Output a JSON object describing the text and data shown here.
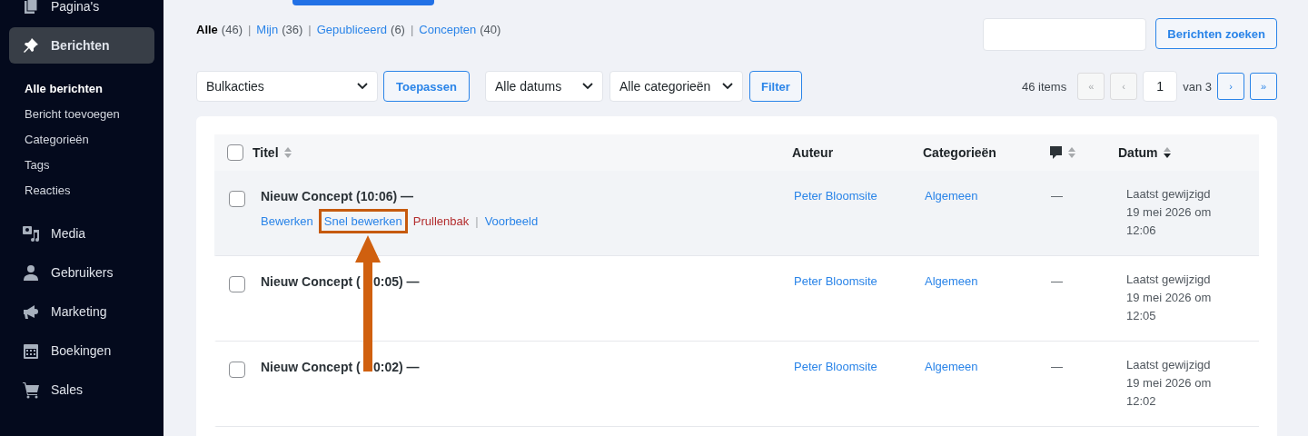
{
  "sidebar": {
    "items": [
      {
        "label": "Pagina's",
        "selected": false
      },
      {
        "label": "Berichten",
        "selected": true,
        "children": [
          {
            "label": "Alle berichten",
            "selected": true
          },
          {
            "label": "Bericht toevoegen",
            "selected": false
          },
          {
            "label": "Categorieën",
            "selected": false
          },
          {
            "label": "Tags",
            "selected": false
          },
          {
            "label": "Reacties",
            "selected": false
          }
        ]
      },
      {
        "label": "Media",
        "selected": false
      },
      {
        "label": "Gebruikers",
        "selected": false
      },
      {
        "label": "Marketing",
        "selected": false
      },
      {
        "label": "Boekingen",
        "selected": false
      },
      {
        "label": "Sales",
        "selected": false
      }
    ]
  },
  "filters": [
    {
      "label": "Alle",
      "count": "(46)",
      "selected": true
    },
    {
      "separator": "|",
      "label": "Mijn",
      "count": "(36)",
      "selected": false
    },
    {
      "separator": "|",
      "label": "Gepubliceerd",
      "count": "(6)",
      "selected": false
    },
    {
      "separator": "|",
      "label": "Concepten",
      "count": "(40)",
      "selected": false
    }
  ],
  "search": {
    "button": "Berichten zoeken"
  },
  "toolbar": {
    "bulk": "Bulkacties",
    "apply": "Toepassen",
    "dates": "Alle datums",
    "categories": "Alle categorieën",
    "filter": "Filter"
  },
  "pagination": {
    "items": "46 items",
    "first": "«",
    "prev": "‹",
    "page": "1",
    "of": "van 3",
    "next": "›",
    "last": "»"
  },
  "table": {
    "columns": [
      {
        "kind": "check",
        "checked": false
      },
      {
        "kind": "text",
        "label": "Titel",
        "sorted": false
      },
      {
        "kind": "text",
        "label": "Auteur"
      },
      {
        "kind": "text",
        "label": "Categorieën"
      },
      {
        "kind": "comments",
        "sorted": false
      },
      {
        "kind": "text",
        "label": "Datum",
        "sorted": true
      }
    ],
    "rows": [
      {
        "title_parts": [
          "Nieuw Concept (10:06) —"
        ],
        "checked": false,
        "hovered": true,
        "actions": [
          {
            "label": "Bewerken",
            "kind": "link",
            "highlighted": false
          },
          {
            "label": "Snel bewerken",
            "kind": "link",
            "highlighted": true
          },
          {
            "label": "Prullenbak",
            "kind": "delete",
            "highlighted": false
          },
          {
            "separator": "|",
            "label": "Voorbeeld",
            "kind": "link",
            "highlighted": false
          }
        ],
        "author": "Peter Bloomsite",
        "category": "Algemeen",
        "comments": "—",
        "date": [
          "Laatst gewijzigd",
          "19 mei 2026 om",
          "12:06"
        ]
      },
      {
        "title_parts": [
          "Nieuw Concept (",
          "0:05) —"
        ],
        "checked": false,
        "hovered": false,
        "author": "Peter Bloomsite",
        "category": "Algemeen",
        "comments": "—",
        "date": [
          "Laatst gewijzigd",
          "19 mei 2026 om",
          "12:05"
        ]
      },
      {
        "title_parts": [
          "Nieuw Concept (",
          "0:02) —"
        ],
        "checked": false,
        "hovered": false,
        "author": "Peter Bloomsite",
        "category": "Algemeen",
        "comments": "—",
        "date": [
          "Laatst gewijzigd",
          "19 mei 2026 om",
          "12:02"
        ]
      }
    ]
  }
}
